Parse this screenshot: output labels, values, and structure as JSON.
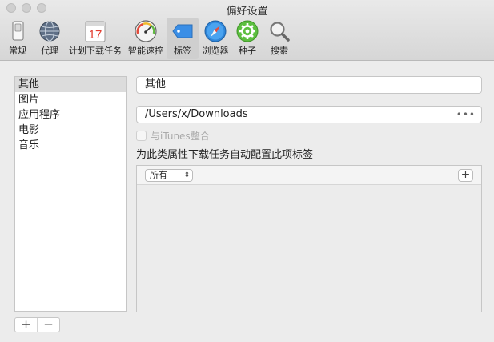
{
  "window": {
    "title": "偏好设置"
  },
  "toolbar": [
    {
      "label": "常规",
      "icon": "general-switch-icon"
    },
    {
      "label": "代理",
      "icon": "globe-icon"
    },
    {
      "label": "计划下载任务",
      "icon": "calendar-icon",
      "badge": "17"
    },
    {
      "label": "智能速控",
      "icon": "speedometer-icon"
    },
    {
      "label": "标签",
      "icon": "tag-icon",
      "selected": true
    },
    {
      "label": "浏览器",
      "icon": "compass-icon"
    },
    {
      "label": "种子",
      "icon": "gear-icon"
    },
    {
      "label": "搜索",
      "icon": "search-icon"
    }
  ],
  "sidebar": {
    "items": [
      "其他",
      "图片",
      "应用程序",
      "电影",
      "音乐"
    ],
    "selected": "其他"
  },
  "buttons": {
    "add": "+",
    "remove": "−",
    "rule_add": "+",
    "path_more": "•••"
  },
  "form": {
    "tag_name": "其他",
    "path": "/Users/x/Downloads",
    "itunes_label": "与iTunes整合",
    "description": "为此类属性下载任务自动配置此项标签",
    "match_select": "所有"
  },
  "colors": {
    "accent": "#3a8ee6",
    "selected_bg": "#dcdcdc"
  }
}
